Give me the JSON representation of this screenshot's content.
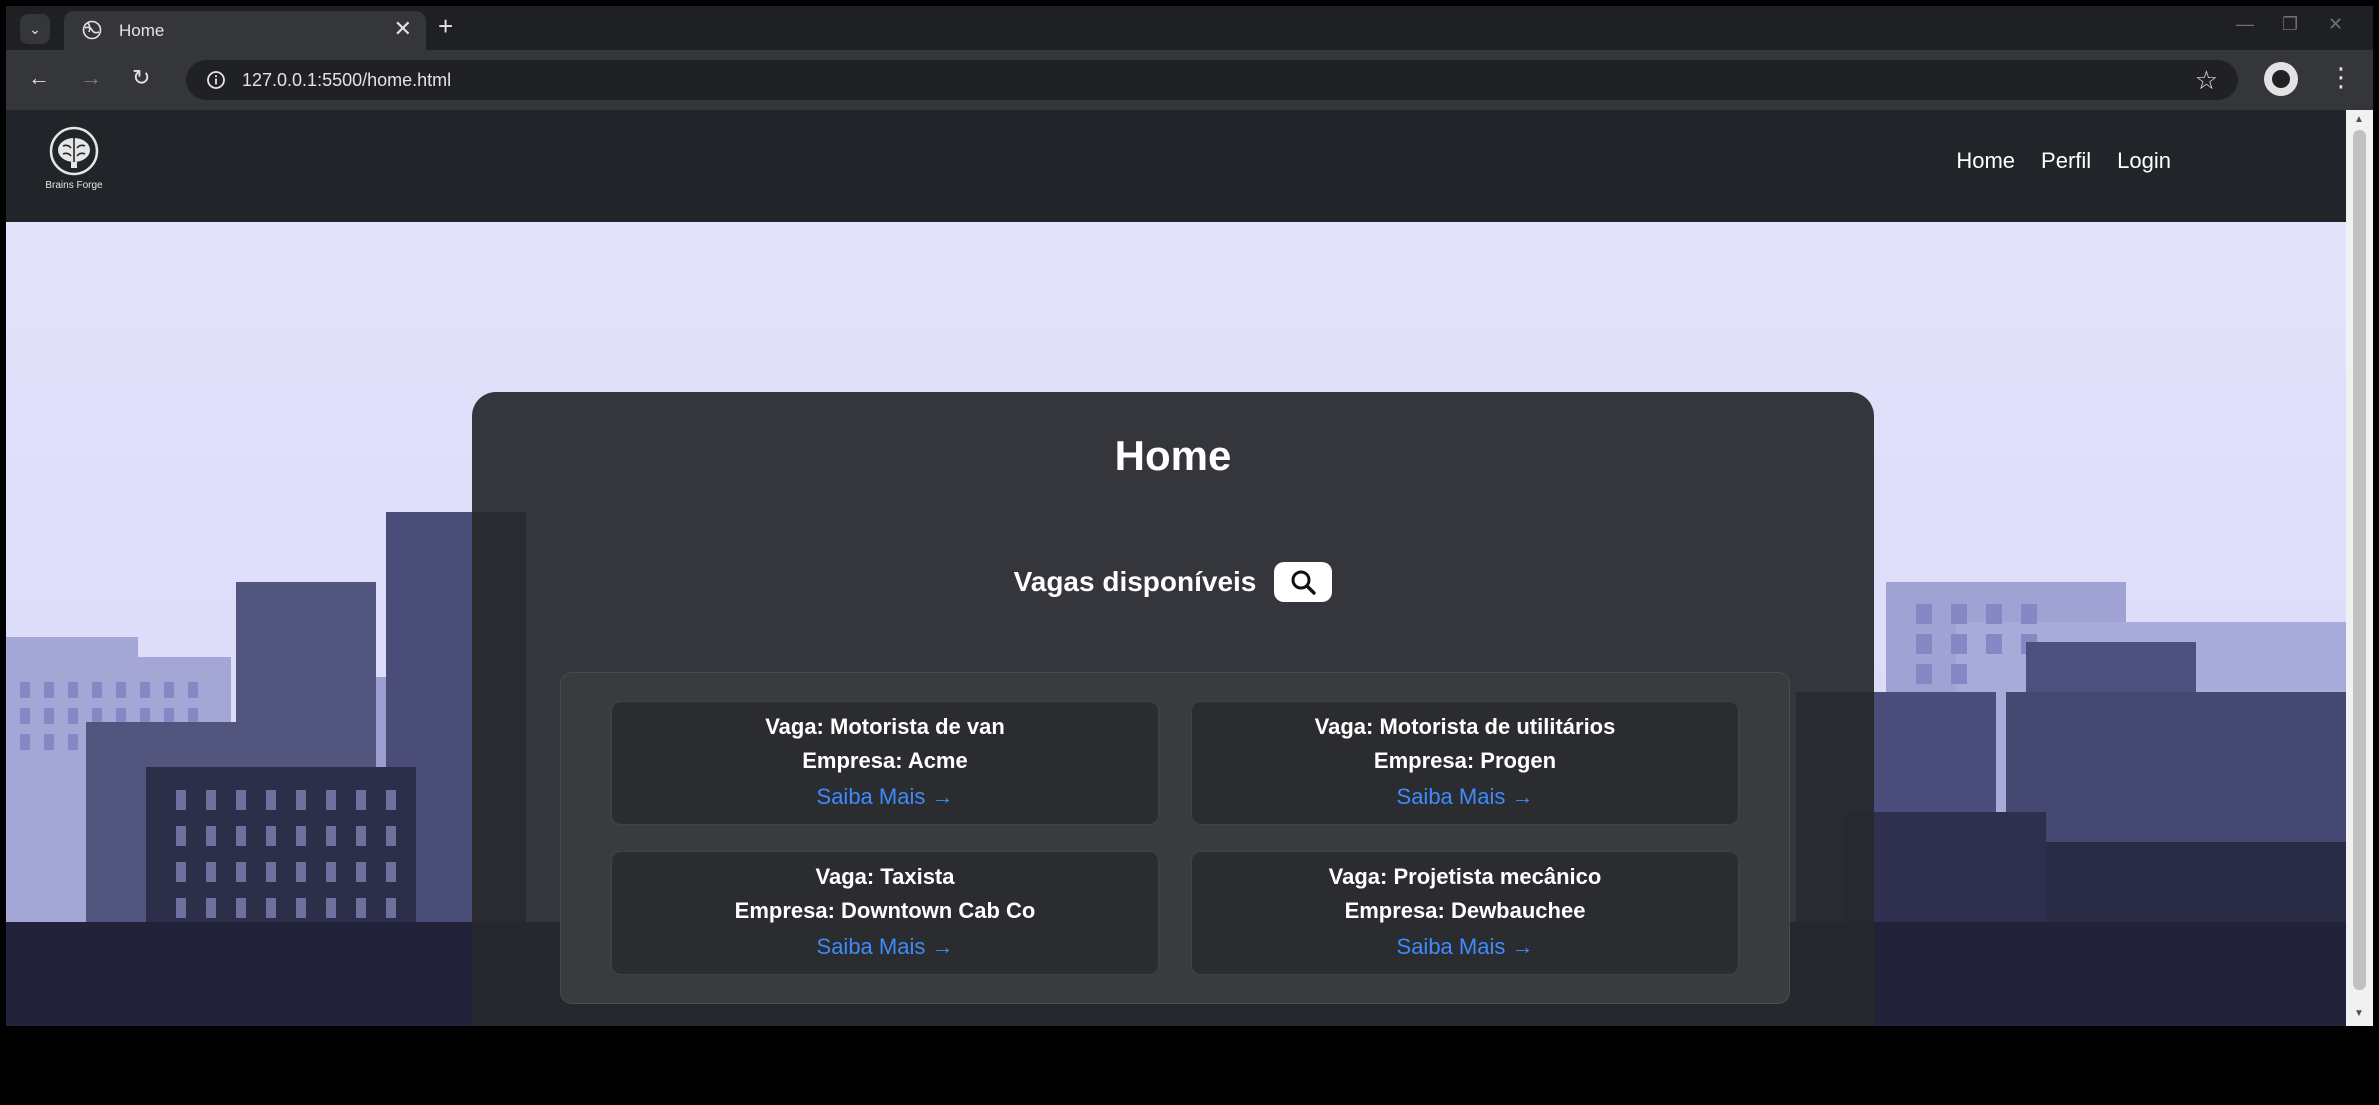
{
  "browser": {
    "tab_title": "Home",
    "tab_close": "✕",
    "new_tab": "+",
    "tab_list_icon": "⌄",
    "url": "127.0.0.1:5500/home.html",
    "star": "☆",
    "menu": "⋮",
    "back": "←",
    "forward": "→",
    "reload": "↻",
    "minimize": "—",
    "restore": "❐",
    "close": "✕"
  },
  "navbar": {
    "brand_name": "Brains Forge",
    "links": [
      "Home",
      "Perfil",
      "Login"
    ]
  },
  "main": {
    "title": "Home",
    "subtitle": "Vagas disponíveis",
    "link_arrow": "→",
    "jobs": [
      {
        "vaga": "Vaga: Motorista de van",
        "empresa": "Empresa: Acme",
        "link": "Saiba Mais"
      },
      {
        "vaga": "Vaga: Motorista de utilitários",
        "empresa": "Empresa: Progen",
        "link": "Saiba Mais"
      },
      {
        "vaga": "Vaga: Taxista",
        "empresa": "Empresa: Downtown Cab Co",
        "link": "Saiba Mais"
      },
      {
        "vaga": "Vaga: Projetista mecânico",
        "empresa": "Empresa: Dewbauchee",
        "link": "Saiba Mais"
      }
    ]
  },
  "colors": {
    "navbar_bg": "#212529",
    "card_bg": "#28292c",
    "link_blue": "#3d8bfd",
    "sky": "#e3e3fb"
  }
}
